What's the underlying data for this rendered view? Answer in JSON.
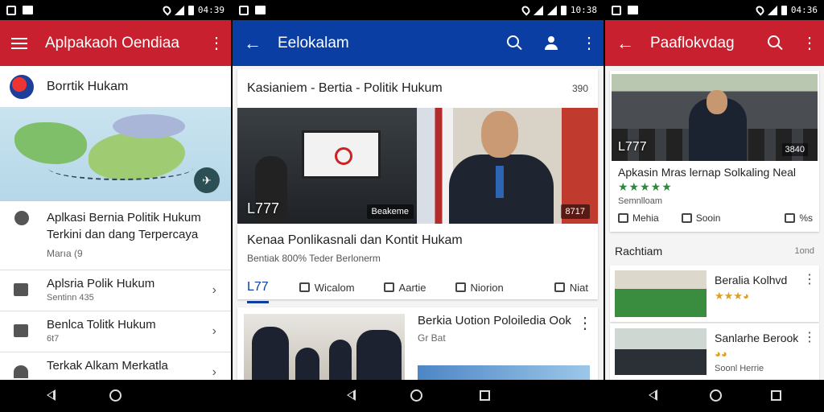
{
  "status": [
    {
      "time": "04:39"
    },
    {
      "time": "10:38"
    },
    {
      "time": "04:36"
    }
  ],
  "panel1": {
    "title": "Aplpakaoh Oendiaa",
    "header": "Borrtik Hukam",
    "logo_text": "ᐧ",
    "featured": {
      "title": "Aplkasi Bernia Politik Hukum Terkini dan dang Terpercaya",
      "sub": "Marıa (9"
    },
    "rows": [
      {
        "title": "Aplsria Polik Hukum",
        "sub": "Sentinn 435"
      },
      {
        "title": "Benlca Tolitk Hukum",
        "sub": "6t7"
      },
      {
        "title": "Terkak Alkam Merkatla",
        "sub": ""
      }
    ]
  },
  "panel2": {
    "title": "Eelokalam",
    "card1": {
      "title": "Kasianiem - Bertia - Politik Hukum",
      "count": "390",
      "caption": "L777",
      "overlay1": "Beakeme",
      "overlay2": "8717",
      "headline": "Kenaa Ponlikasnali dan Kontit Hukam",
      "meta": "Bentiak  800% Teder Berlonerm",
      "actions": [
        "L77",
        "Wicalom",
        "Aartie",
        "Niorion",
        "Niat"
      ]
    },
    "card2": {
      "title": "Berkia Uotion Poloiledia Ook",
      "sub": "Gr Bat"
    }
  },
  "panel3": {
    "title": "Paaflokvdag",
    "card": {
      "caption": "L777",
      "count": "3840",
      "headline": "Apkasin Mras lernap Solkaling Neal",
      "stars": "★★★★★",
      "sub": "Semnlloam",
      "actions": [
        "Mehia",
        "Sooin",
        "%s"
      ]
    },
    "section": {
      "title": "Rachtiam",
      "right": "1ond"
    },
    "items": [
      {
        "title": "Beralia Kolhvd",
        "stars": "★★★◕",
        "sub": ""
      },
      {
        "title": "Sanlarhe Berook",
        "stars": "◕◕",
        "sub": "Soonl Herrie"
      }
    ]
  },
  "colors": {
    "red": "#c8202e",
    "blue": "#0a3ea2"
  }
}
